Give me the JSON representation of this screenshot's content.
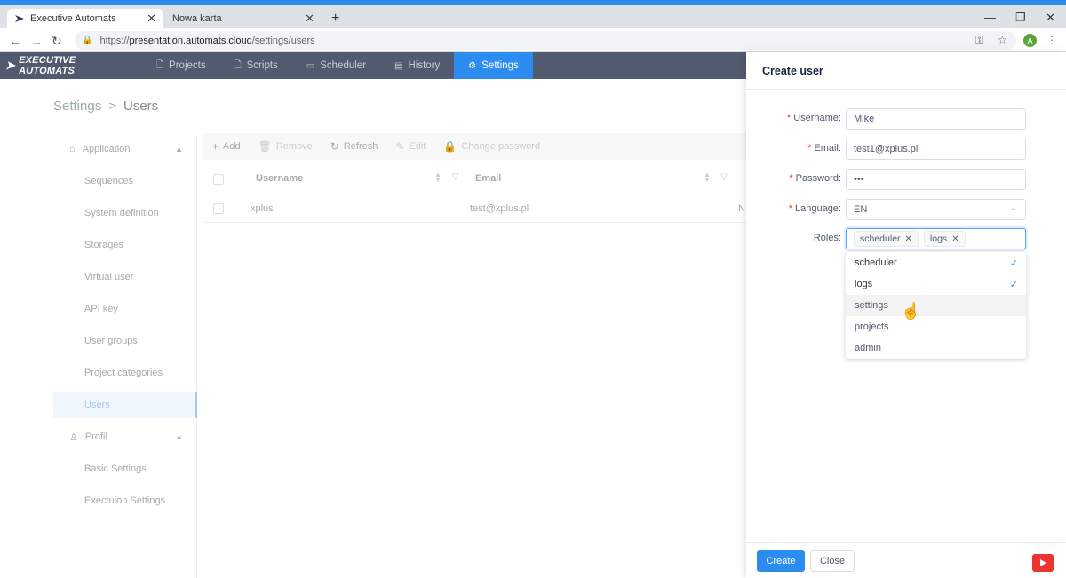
{
  "browser": {
    "tabs": [
      {
        "label": "Executive Automats",
        "active": true
      },
      {
        "label": "Nowa karta",
        "active": false
      }
    ],
    "url_prefix": "https://",
    "url_host": "presentation.automats.cloud",
    "url_path": "/settings/users",
    "avatar_letter": "A"
  },
  "app": {
    "logo": "EXECUTIVE AUTOMATS",
    "nav": [
      {
        "label": "Projects",
        "icon": "file-icon"
      },
      {
        "label": "Scripts",
        "icon": "file-icon"
      },
      {
        "label": "Scheduler",
        "icon": "calendar-icon"
      },
      {
        "label": "History",
        "icon": "list-icon"
      },
      {
        "label": "Settings",
        "icon": "gear-icon",
        "active": true
      }
    ],
    "accent": "#2d8cf0"
  },
  "breadcrumb": {
    "root": "Settings",
    "sep": ">",
    "current": "Users"
  },
  "sidebar": {
    "group1": "Application",
    "items1": [
      "Sequences",
      "System definition",
      "Storages",
      "Virtual user",
      "API key",
      "User groups",
      "Project categories",
      "Users"
    ],
    "group2": "Profil",
    "items2": [
      "Basic Settings",
      "Exectuion Settings"
    ],
    "active": "Users"
  },
  "toolbar": {
    "add": "Add",
    "remove": "Remove",
    "refresh": "Refresh",
    "edit": "Edit",
    "change_password": "Change password"
  },
  "table": {
    "headers": [
      "Username",
      "Email"
    ],
    "rows": [
      {
        "username": "xplus",
        "email": "test@xplus.pl",
        "extra": "N"
      }
    ]
  },
  "drawer": {
    "title": "Create user",
    "fields": {
      "username_label": "Username",
      "username_value": "Mike",
      "email_label": "Email",
      "email_value": "test1@xplus.pl",
      "password_label": "Password",
      "password_value": "•••",
      "language_label": "Language",
      "language_value": "EN",
      "roles_label": "Roles"
    },
    "selected_roles": [
      "scheduler",
      "logs"
    ],
    "role_options": [
      {
        "label": "scheduler",
        "selected": true
      },
      {
        "label": "logs",
        "selected": true
      },
      {
        "label": "settings",
        "selected": false,
        "hover": true
      },
      {
        "label": "projects",
        "selected": false
      },
      {
        "label": "admin",
        "selected": false
      }
    ],
    "create": "Create",
    "close": "Close"
  }
}
